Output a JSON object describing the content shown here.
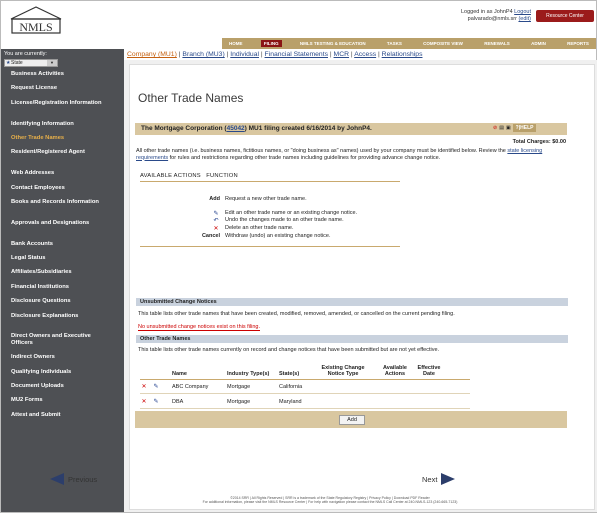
{
  "header": {
    "logo_text": "NMLS",
    "logged_in_as": "Logged in as JohnP4",
    "logout": "Logout",
    "email": "palvarado@nmls.srr",
    "edit": "(edit)",
    "resource_center": "Resource Center"
  },
  "topnav": [
    "HOME",
    "FILING",
    "NMLS TESTING & EDUCATION",
    "TASKS",
    "COMPOSITE VIEW",
    "RENEWALS",
    "ADMIN",
    "REPORTS"
  ],
  "subnav": {
    "company": "Company (MU1)",
    "branch": "Branch (MU3)",
    "individual": "Individual",
    "financial": "Financial Statements",
    "mcr": "MCR",
    "access": "Access",
    "relationships": "Relationships"
  },
  "sidebar": {
    "current_label": "You are currently:",
    "state_value": "State",
    "items": [
      "Business Activities",
      "Request License",
      "License/Registration Information",
      "Identifying Information",
      "Other Trade Names",
      "Resident/Registered Agent",
      "Web Addresses",
      "Contact Employees",
      "Books and Records Information",
      "Approvals and Designations",
      "Bank Accounts",
      "Legal Status",
      "Affiliates/Subsidiaries",
      "Financial Institutions",
      "Disclosure Questions",
      "Disclosure Explanations",
      "Direct Owners and Executive Officers",
      "Indirect Owners",
      "Qualifying Individuals",
      "Document Uploads",
      "MU2 Forms",
      "Attest and Submit"
    ],
    "active_index": 4
  },
  "main": {
    "title": "Other Trade Names",
    "filing_prefix": "The Mortgage Corporation (",
    "filing_id": "45042",
    "filing_suffix": ") MU1 filing created 6/16/2014 by JohnP4.",
    "help": "HELP",
    "total_charges": "Total Charges: $0.00",
    "intro_1": "All other trade names (i.e. business names, fictitious names, or \"doing business as\" names) used by your company must be identified below. Review the ",
    "intro_link": "state licensing requirements",
    "intro_2": " for rules and restrictions regarding other trade names including guidelines for providing advance change notice.",
    "available_actions": "AVAILABLE ACTIONS",
    "function": "FUNCTION",
    "actions": [
      {
        "key": "Add",
        "desc": "Request a new other trade name."
      },
      {
        "key": "",
        "desc": "Edit an other trade name or an existing change notice."
      },
      {
        "key": "",
        "desc": "Undo the changes made to an other trade name."
      },
      {
        "key": "",
        "desc": "Delete an other trade name."
      },
      {
        "key": "Cancel",
        "desc": "Withdraw (undo) an existing change notice."
      }
    ],
    "unsubmitted_head": "Unsubmitted Change Notices",
    "unsubmitted_text": "This table lists other trade names that have been created, modified, removed, amended, or cancelled on the current pending filing.",
    "no_notices": "No unsubmitted change notices exist on this filing.",
    "other_head": "Other Trade Names",
    "other_text": "This table lists other trade names currently on record and change notices that have been submitted but are not yet effective.",
    "columns": [
      "Name",
      "Industry Type(s)",
      "State(s)",
      "Existing Change Notice Type",
      "Available Actions",
      "Effective Date"
    ],
    "rows": [
      {
        "name": "ABC Company",
        "industry": "Mortgage",
        "state": "California"
      },
      {
        "name": "DBA",
        "industry": "Mortgage",
        "state": "Maryland"
      }
    ],
    "add_button": "Add",
    "previous": "Previous",
    "next": "Next"
  },
  "footer": {
    "line1": "©2014 SRR | All Rights Reserved | SRR is a trademark of the State Regulatory Registry | Privacy Policy | Download PDF Reader",
    "line2": "For additional information, please visit the NMLS Resource Center | For help with navigation please contact the NMLS Call Center at 240-NMLS-123 (240-665-7123)"
  }
}
